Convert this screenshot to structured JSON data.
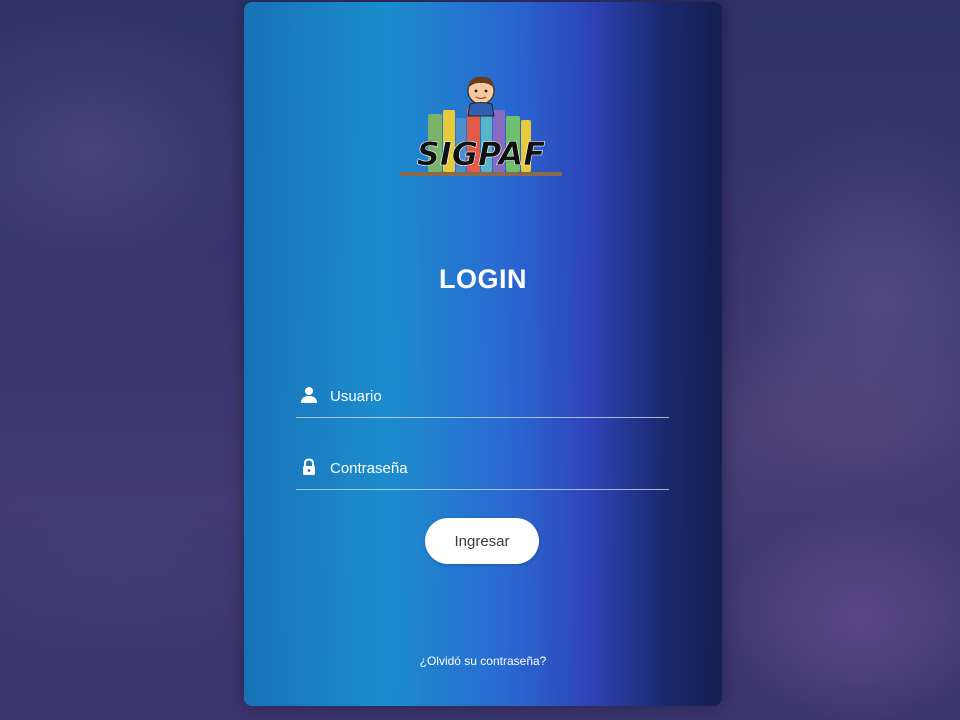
{
  "logo": {
    "text": "SIGPAF",
    "book_colors": [
      "#7ab36a",
      "#e8c93a",
      "#4a90d0",
      "#e25a4a",
      "#5ab4c8",
      "#8a6ac0",
      "#6cc070"
    ]
  },
  "login": {
    "title": "LOGIN",
    "username_placeholder": "Usuario",
    "password_placeholder": "Contraseña",
    "submit_label": "Ingresar",
    "forgot_label": "¿Olvidó su contraseña?"
  },
  "icons": {
    "username": "user-icon",
    "password": "lock-icon"
  },
  "colors": {
    "button_bg": "#ffffff",
    "button_text": "#3a3a3a",
    "text": "#ffffff"
  }
}
